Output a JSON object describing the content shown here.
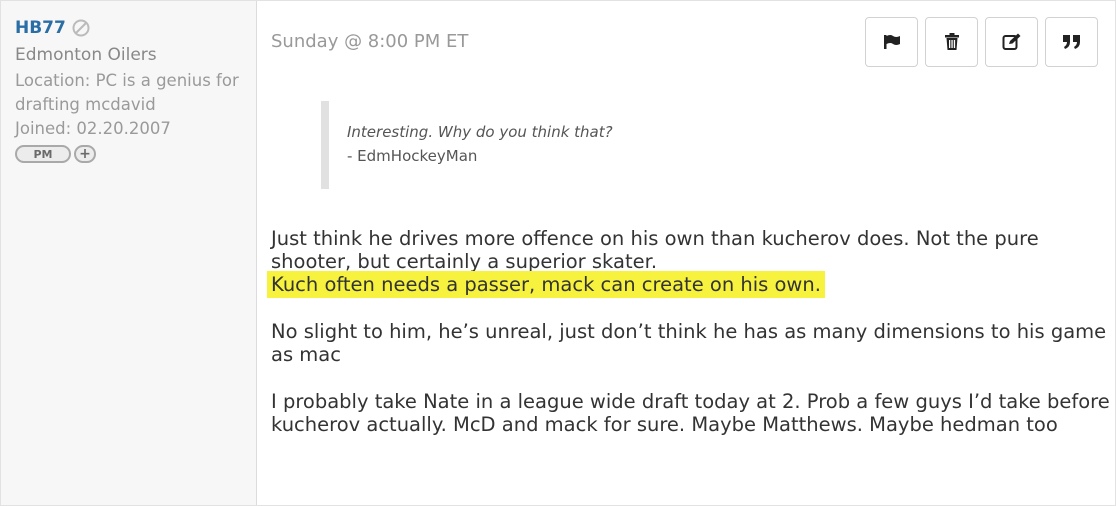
{
  "user": {
    "username": "HB77",
    "team": "Edmonton Oilers",
    "location": "Location: PC is a genius for drafting mcdavid",
    "joined": "Joined: 02.20.2007",
    "pm_label": "PM",
    "add_label": "+"
  },
  "post": {
    "date": "Sunday @ 8:00 PM ET",
    "actions": {
      "report": "flag-icon",
      "delete": "trash-icon",
      "edit": "edit-icon",
      "quote": "quote-icon"
    },
    "quote": {
      "text": "Interesting. Why do you think that?",
      "author": "- EdmHockeyMan"
    },
    "body": {
      "p1": "Just think he drives more offence on his own than kucherov does. Not the pure shooter, but certainly a superior skater.",
      "p1_highlight": "Kuch often needs a passer, mack can create on his own.",
      "p2": "No slight to him, he’s unreal, just don’t think he has as many dimensions to his game as mac",
      "p3": "I probably take Nate in a league wide draft today at 2. Prob a few guys I’d take before kucherov actually. McD and mack for sure. Maybe Matthews. Maybe hedman too"
    }
  },
  "colors": {
    "username": "#2a6ea6",
    "highlight": "#f6f23e",
    "sidebar_bg": "#f7f7f7"
  }
}
